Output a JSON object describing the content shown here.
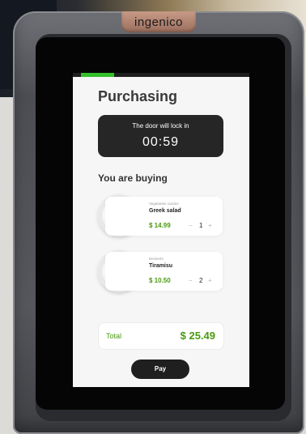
{
  "device": {
    "brand": "ingenico"
  },
  "progress": {
    "fraction": 0.19,
    "color": "#33c12a"
  },
  "screen": {
    "title": "Purchasing",
    "lock": {
      "text": "The door will lock in",
      "timer": "00:59"
    },
    "section_title": "You are buying",
    "items": [
      {
        "category": "Vegetarian cuisine",
        "name": "Greek salad",
        "price": "$ 14.99",
        "minus": "−",
        "quantity": "1",
        "plus": "+"
      },
      {
        "category": "Desserts",
        "name": "Tiramisu",
        "price": "$ 10.50",
        "minus": "−",
        "quantity": "2",
        "plus": "+"
      }
    ],
    "total": {
      "label": "Total",
      "value": "$ 25.49"
    },
    "pay_label": "Pay"
  },
  "colors": {
    "accent": "#4a9a10",
    "dark": "#1f1f1f"
  }
}
